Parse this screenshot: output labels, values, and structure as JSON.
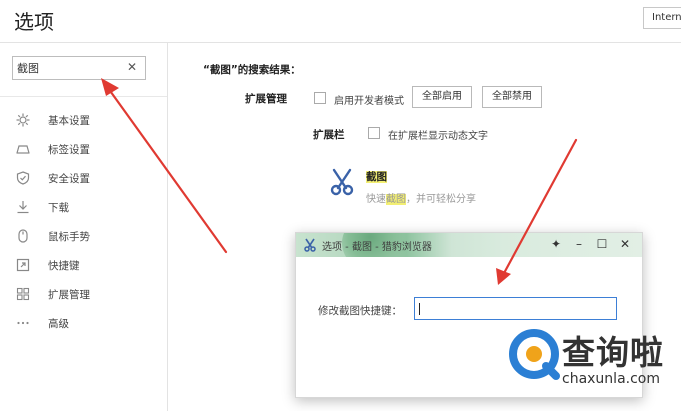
{
  "page": {
    "title": "选项"
  },
  "header": {
    "internet_button": "Intern"
  },
  "sidebar": {
    "search": {
      "value": "截图",
      "placeholder": ""
    },
    "items": [
      {
        "label": "基本设置",
        "icon": "gear-icon"
      },
      {
        "label": "标签设置",
        "icon": "tab-icon"
      },
      {
        "label": "安全设置",
        "icon": "shield-icon"
      },
      {
        "label": "下载",
        "icon": "download-icon"
      },
      {
        "label": "鼠标手势",
        "icon": "mouse-icon"
      },
      {
        "label": "快捷键",
        "icon": "shortcut-icon"
      },
      {
        "label": "扩展管理",
        "icon": "extensions-icon"
      },
      {
        "label": "高级",
        "icon": "more-icon"
      }
    ]
  },
  "main": {
    "results_title": "“截图”的搜索结果：",
    "extension_management": {
      "label": "扩展管理",
      "dev_mode_label": "启用开发者模式",
      "enable_all": "全部启用",
      "disable_all": "全部禁用"
    },
    "extension_bar": {
      "label": "扩展栏",
      "show_text_label": "在扩展栏显示动态文字"
    },
    "extension": {
      "name": "截图",
      "desc_before": "快速",
      "desc_highlight": "截图",
      "desc_after": "，并可轻松分享",
      "icon": "scissors-icon"
    }
  },
  "dialog": {
    "title": "选项 - 截图 - 猎豹浏览器",
    "field_label": "修改截图快捷键：",
    "field_value": ""
  },
  "watermark": {
    "text": "查询啦",
    "url": "chaxunla.com"
  },
  "colors": {
    "arrow": "#e03a32",
    "input_focus": "#3d7fd6",
    "highlight": "#f3ef73"
  }
}
